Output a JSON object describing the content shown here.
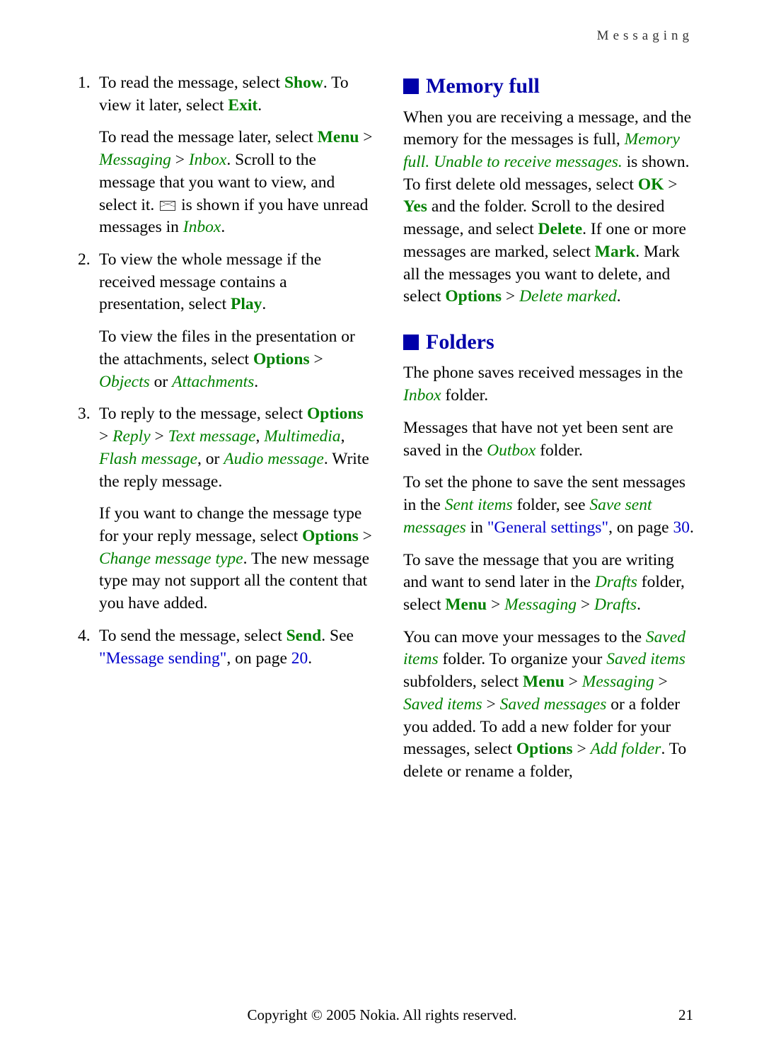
{
  "header": "Messaging",
  "left": {
    "items": [
      {
        "num": "1.",
        "l1a": "To read the message, select ",
        "l1b": "Show",
        "l1c": ". To view it later, select ",
        "l1d": "Exit",
        "l1e": ".",
        "s1a": "To read the message later, select ",
        "s1b": "Menu",
        "s1c": " > ",
        "s1d": "Messaging",
        "s1e": " > ",
        "s1f": "Inbox",
        "s1g": ". Scroll to the message that you want to view, and select it.  ",
        "s1h": " is shown if you have unread messages in ",
        "s1i": "Inbox",
        "s1j": "."
      },
      {
        "num": "2.",
        "l2a": "To view the whole message if the received message contains a presentation, select ",
        "l2b": "Play",
        "l2c": ".",
        "s2a": "To view the files in the presentation or the attachments, select ",
        "s2b": "Options",
        "s2c": " > ",
        "s2d": "Objects",
        "s2e": " or ",
        "s2f": "Attachments",
        "s2g": "."
      },
      {
        "num": "3.",
        "l3a": "To reply to the message, select ",
        "l3b": "Options",
        "l3c": " > ",
        "l3d": "Reply",
        "l3e": " > ",
        "l3f": "Text message",
        "l3g": ", ",
        "l3h": "Multimedia",
        "l3i": ", ",
        "l3j": "Flash message",
        "l3k": ", or ",
        "l3l": "Audio message",
        "l3m": ". Write the reply message.",
        "s3a": "If you want to change the message type for your reply message, select ",
        "s3b": "Options",
        "s3c": " > ",
        "s3d": "Change message type",
        "s3e": ". The new message type may not support all the content that you have added."
      },
      {
        "num": "4.",
        "l4a": "To send the message, select ",
        "l4b": "Send",
        "l4c": ". See ",
        "l4d": "\"Message sending\"",
        "l4e": ", on page ",
        "l4f": "20",
        "l4g": "."
      }
    ]
  },
  "right": {
    "h1": "Memory full",
    "p1a": "When you are receiving a message, and the memory for the messages is full, ",
    "p1b": "Memory full. Unable to receive messages.",
    "p1c": " is shown. To first delete old messages, select ",
    "p1d": "OK",
    "p1e": " > ",
    "p1f": "Yes",
    "p1g": " and the folder. Scroll to the desired message, and select ",
    "p1h": "Delete",
    "p1i": ". If one or more messages are marked, select ",
    "p1j": "Mark",
    "p1k": ". Mark all the messages you want to delete, and select ",
    "p1l": "Options",
    "p1m": " > ",
    "p1n": "Delete marked",
    "p1o": ".",
    "h2": "Folders",
    "p2a": "The phone saves received messages in the ",
    "p2b": "Inbox",
    "p2c": " folder.",
    "p3a": "Messages that have not yet been sent are saved in the ",
    "p3b": "Outbox",
    "p3c": " folder.",
    "p4a": "To set the phone to save the sent messages in the ",
    "p4b": "Sent items",
    "p4c": " folder, see ",
    "p4d": "Save sent messages",
    "p4e": " in ",
    "p4f": "\"General settings\"",
    "p4g": ", on page ",
    "p4h": "30",
    "p4i": ".",
    "p5a": "To save the message that you are writing and want to send later in the ",
    "p5b": "Drafts",
    "p5c": " folder, select ",
    "p5d": "Menu",
    "p5e": " > ",
    "p5f": "Messaging",
    "p5g": " > ",
    "p5h": "Drafts",
    "p5i": ".",
    "p6a": "You can move your messages to the ",
    "p6b": "Saved items",
    "p6c": " folder. To organize your ",
    "p6d": "Saved items",
    "p6e": " subfolders, select ",
    "p6f": "Menu",
    "p6g": " > ",
    "p6h": "Messaging",
    "p6i": " > ",
    "p6j": "Saved items",
    "p6k": " > ",
    "p6l": "Saved messages",
    "p6m": " or a folder you added. To add a new folder for your messages, select ",
    "p6n": "Options",
    "p6o": " > ",
    "p6p": "Add folder",
    "p6q": ". To delete or rename a folder,"
  },
  "footer": "Copyright © 2005 Nokia. All rights reserved.",
  "pagenum": "21"
}
